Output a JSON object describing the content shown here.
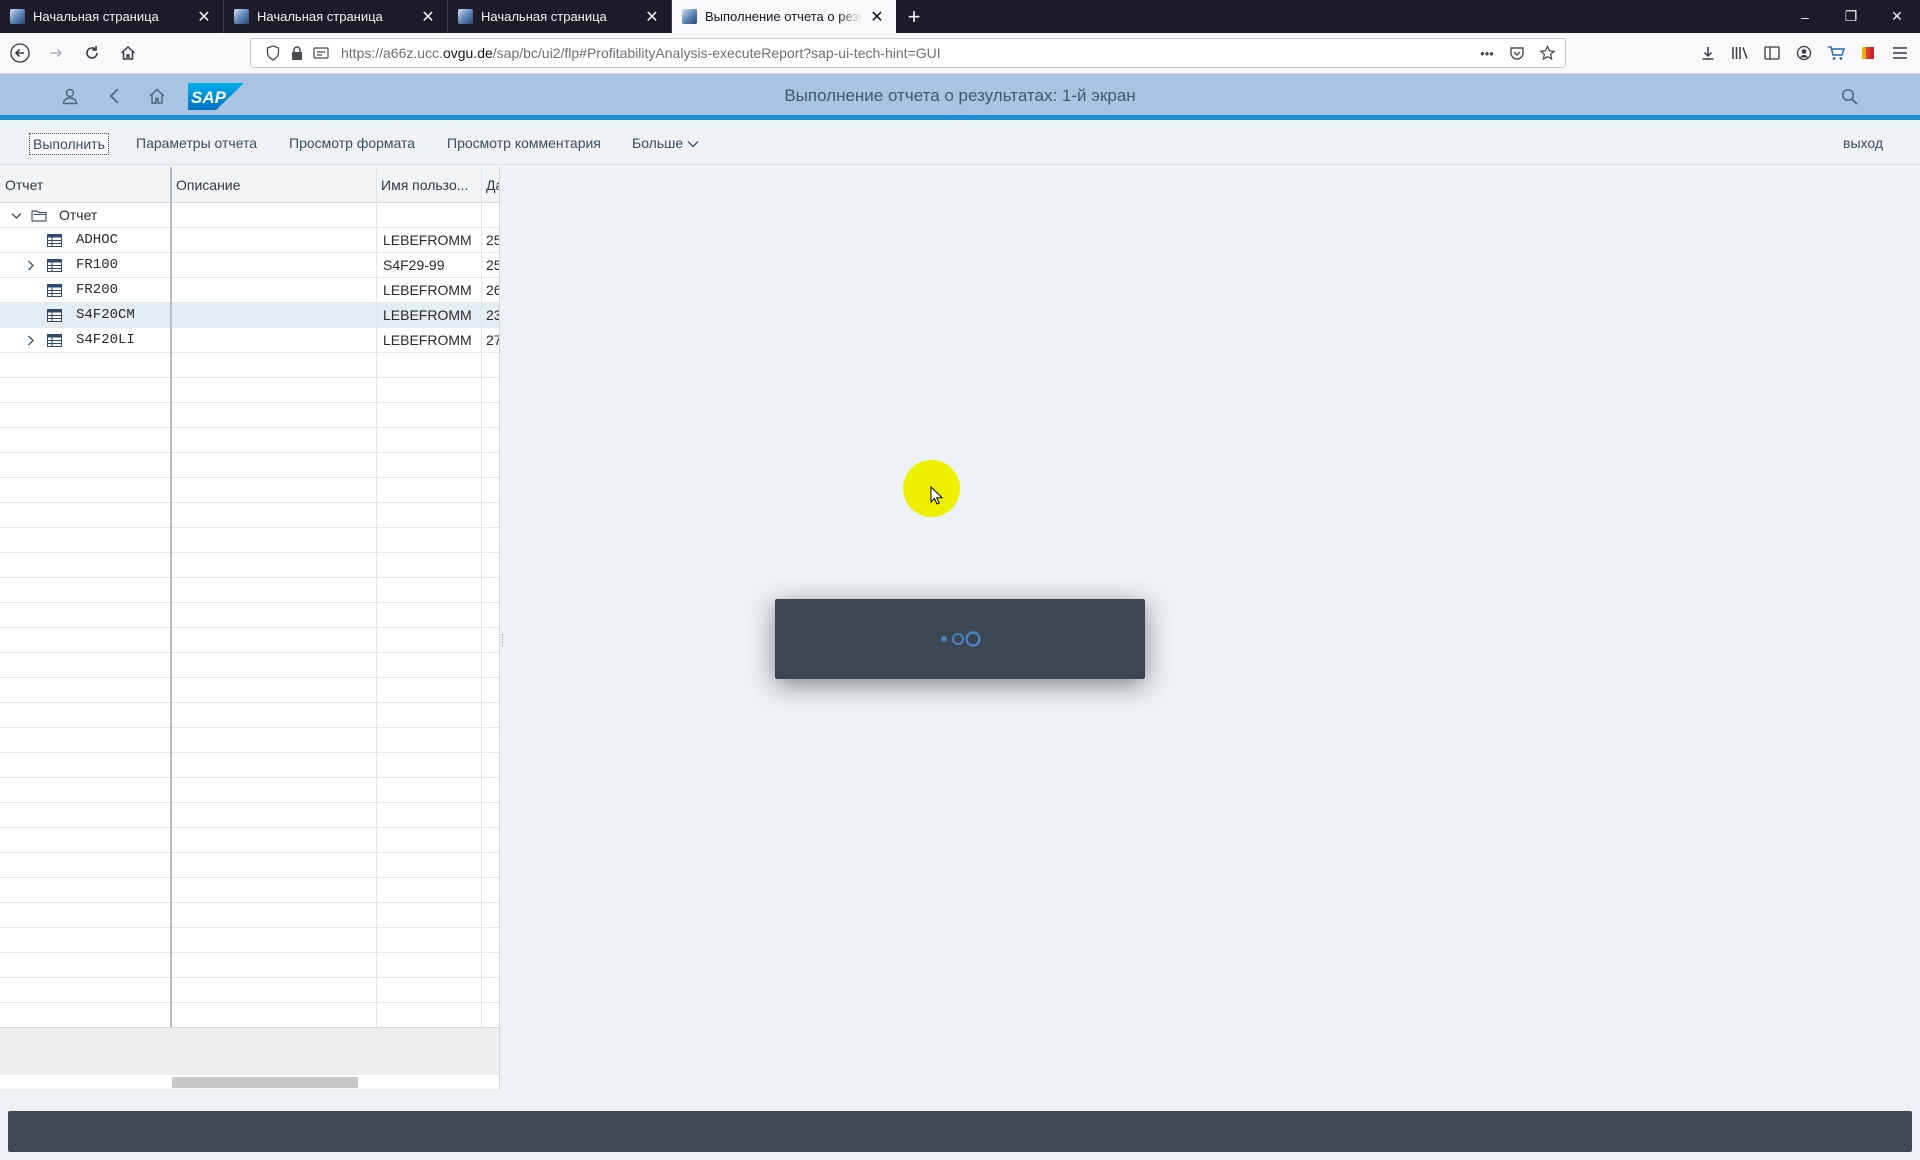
{
  "browser": {
    "tabs": [
      {
        "title": "Начальная страница",
        "active": false
      },
      {
        "title": "Начальная страница",
        "active": false
      },
      {
        "title": "Начальная страница",
        "active": false
      },
      {
        "title": "Выполнение отчета о результатах: 1-й экран",
        "active": true
      }
    ],
    "url": {
      "prefix": "https://a66z.ucc.",
      "domain": "ovgu.de",
      "path": "/sap/bc/ui2/flp#ProfitabilityAnalysis-executeReport?sap-ui-tech-hint=GUI"
    }
  },
  "shell": {
    "title": "Выполнение отчета о результатах: 1-й экран",
    "logo_text": "SAP",
    "header_color": "#a9c4e0",
    "accent_color": "#1a8cd8"
  },
  "toolbar": {
    "execute": "Выполнить",
    "report_params": "Параметры отчета",
    "format_view": "Просмотр формата",
    "comment_view": "Просмотр комментария",
    "more": "Больше",
    "exit": "выход"
  },
  "grid": {
    "columns": [
      "Отчет",
      "Описание",
      "Имя пользо...",
      "Да"
    ],
    "root": {
      "label": "Отчет",
      "expanded": true
    },
    "rows": [
      {
        "name": "ADHOC",
        "description": "",
        "user": "LEBEFROMM",
        "date": "25",
        "expandable": false,
        "selected": false
      },
      {
        "name": "FR100",
        "description": "",
        "user": "S4F29-99",
        "date": "25",
        "expandable": true,
        "selected": false
      },
      {
        "name": "FR200",
        "description": "",
        "user": "LEBEFROMM",
        "date": "26",
        "expandable": false,
        "selected": false
      },
      {
        "name": "S4F20CM",
        "description": "",
        "user": "LEBEFROMM",
        "date": "23",
        "expandable": false,
        "selected": true
      },
      {
        "name": "S4F20LI",
        "description": "",
        "user": "LEBEFROMM",
        "date": "27",
        "expandable": true,
        "selected": false
      }
    ]
  },
  "busy_indicator": {
    "visible": true
  }
}
